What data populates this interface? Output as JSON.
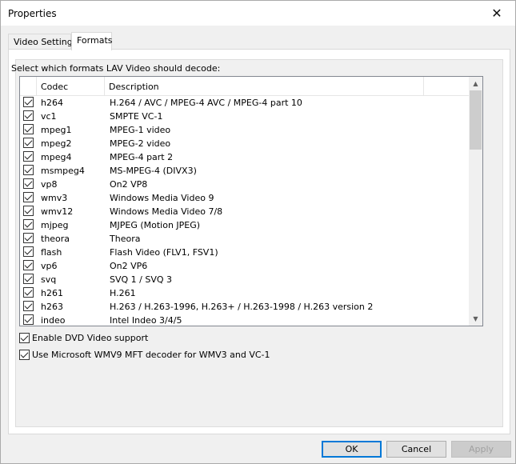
{
  "window": {
    "title": "Properties",
    "close_glyph": "✕"
  },
  "tabs": [
    {
      "label": "Video Settings",
      "active": false
    },
    {
      "label": "Formats",
      "active": true
    }
  ],
  "formats": {
    "prompt": "Select which formats LAV Video should decode:",
    "columns": {
      "codec": "Codec",
      "description": "Description"
    },
    "rows": [
      {
        "codec": "h264",
        "description": "H.264 / AVC / MPEG-4 AVC / MPEG-4 part 10",
        "checked": true
      },
      {
        "codec": "vc1",
        "description": "SMPTE VC-1",
        "checked": true
      },
      {
        "codec": "mpeg1",
        "description": "MPEG-1 video",
        "checked": true
      },
      {
        "codec": "mpeg2",
        "description": "MPEG-2 video",
        "checked": true
      },
      {
        "codec": "mpeg4",
        "description": "MPEG-4 part 2",
        "checked": true
      },
      {
        "codec": "msmpeg4",
        "description": "MS-MPEG-4 (DIVX3)",
        "checked": true
      },
      {
        "codec": "vp8",
        "description": "On2 VP8",
        "checked": true
      },
      {
        "codec": "wmv3",
        "description": "Windows Media Video 9",
        "checked": true
      },
      {
        "codec": "wmv12",
        "description": "Windows Media Video 7/8",
        "checked": true
      },
      {
        "codec": "mjpeg",
        "description": "MJPEG (Motion JPEG)",
        "checked": true
      },
      {
        "codec": "theora",
        "description": "Theora",
        "checked": true
      },
      {
        "codec": "flash",
        "description": "Flash Video (FLV1, FSV1)",
        "checked": true
      },
      {
        "codec": "vp6",
        "description": "On2 VP6",
        "checked": true
      },
      {
        "codec": "svq",
        "description": "SVQ 1 / SVQ 3",
        "checked": true
      },
      {
        "codec": "h261",
        "description": "H.261",
        "checked": true
      },
      {
        "codec": "h263",
        "description": "H.263 / H.263-1996, H.263+ / H.263-1998 / H.263 version 2",
        "checked": true
      },
      {
        "codec": "indeo",
        "description": "Intel Indeo 3/4/5",
        "checked": true
      }
    ]
  },
  "options": {
    "dvd_label": "Enable DVD Video support",
    "dvd_checked": true,
    "wmv9_label": "Use Microsoft WMV9 MFT decoder for WMV3 and VC-1",
    "wmv9_checked": true
  },
  "buttons": {
    "ok": "OK",
    "cancel": "Cancel",
    "apply": "Apply"
  },
  "icons": {
    "scroll_up": "▲",
    "scroll_down": "▼"
  },
  "colors": {
    "accent": "#0078d7",
    "window_bg": "#f0f0f0"
  }
}
